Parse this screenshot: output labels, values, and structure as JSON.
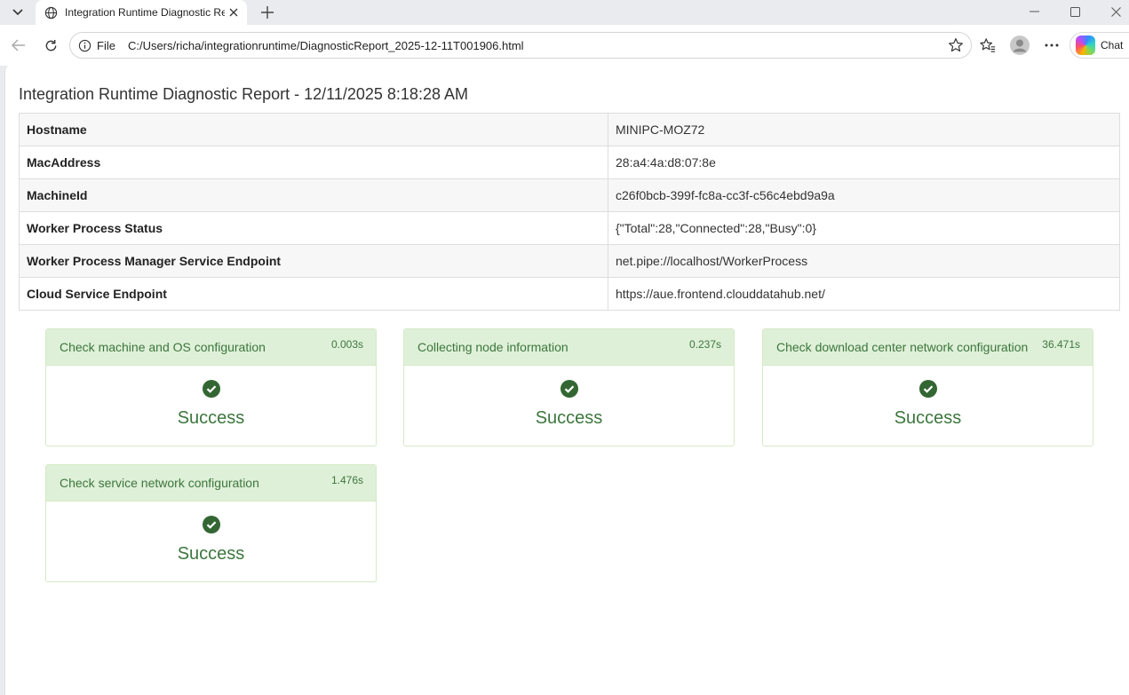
{
  "browser": {
    "tab_title": "Integration Runtime Diagnostic Re",
    "address_scheme": "File",
    "address_url": "C:/Users/richa/integrationruntime/DiagnosticReport_2025-12-11T001906.html",
    "copilot_label": "Chat"
  },
  "report": {
    "title": "Integration Runtime Diagnostic Report - 12/11/2025 8:18:28 AM",
    "info_rows": [
      {
        "key": "Hostname",
        "value": "MINIPC-MOZ72"
      },
      {
        "key": "MacAddress",
        "value": "28:a4:4a:d8:07:8e"
      },
      {
        "key": "MachineId",
        "value": "c26f0bcb-399f-fc8a-cc3f-c56c4ebd9a9a"
      },
      {
        "key": "Worker Process Status",
        "value": "{\"Total\":28,\"Connected\":28,\"Busy\":0}"
      },
      {
        "key": "Worker Process Manager Service Endpoint",
        "value": "net.pipe://localhost/WorkerProcess"
      },
      {
        "key": "Cloud Service Endpoint",
        "value": "https://aue.frontend.clouddatahub.net/"
      }
    ],
    "checks": [
      {
        "title": "Check machine and OS configuration",
        "time": "0.003s",
        "status": "Success"
      },
      {
        "title": "Collecting node information",
        "time": "0.237s",
        "status": "Success"
      },
      {
        "title": "Check download center network configuration",
        "time": "36.471s",
        "status": "Success"
      },
      {
        "title": "Check service network configuration",
        "time": "1.476s",
        "status": "Success"
      }
    ]
  },
  "colors": {
    "success_text": "#3c763d",
    "success_header_bg": "#dff0d8",
    "check_icon": "#336633"
  },
  "icons": [
    "tab-list-icon",
    "globe-icon",
    "close-icon",
    "plus-icon",
    "minimize-icon",
    "maximize-icon",
    "back-arrow-icon",
    "refresh-icon",
    "info-icon",
    "star-icon",
    "favorites-icon",
    "profile-icon",
    "more-icon",
    "copilot-icon",
    "check-circle-icon"
  ]
}
